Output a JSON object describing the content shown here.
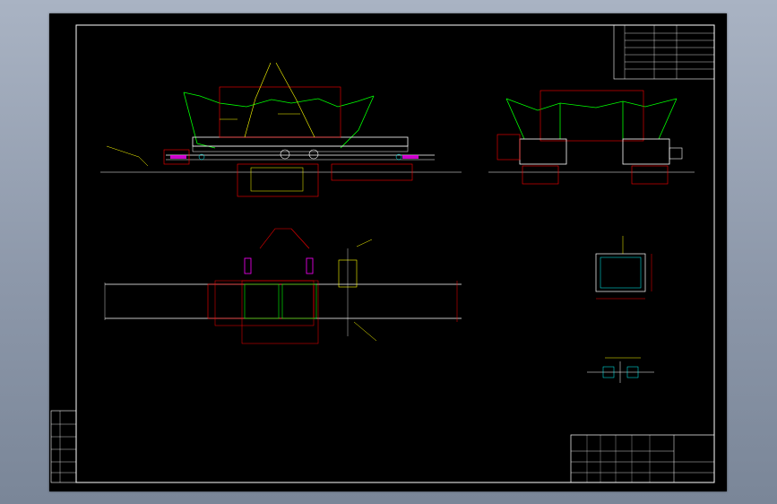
{
  "colors": {
    "background": "#000000",
    "frame": "#ffffff",
    "annotation": "#ffff00",
    "terrain": "#00ff00",
    "dimension": "#ff0000",
    "section": "#00ffff",
    "marker": "#ff00ff"
  },
  "drawing": {
    "views": [
      "elevation-view",
      "end-view",
      "plan-view",
      "detail-view-a",
      "detail-view-b"
    ]
  }
}
